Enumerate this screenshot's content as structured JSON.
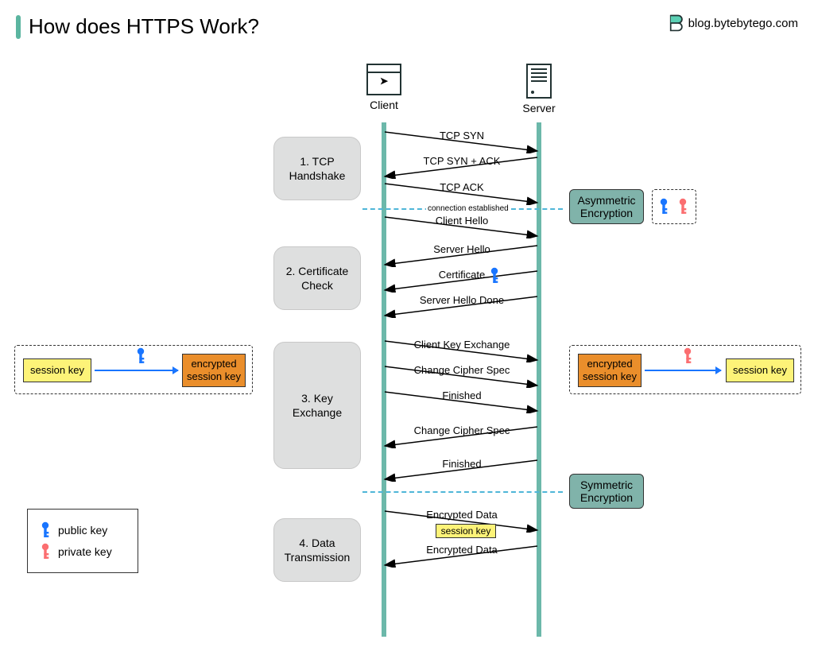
{
  "title": "How does HTTPS Work?",
  "brand": "blog.bytebytego.com",
  "actors": {
    "client": "Client",
    "server": "Server"
  },
  "phases": {
    "p1": "1. TCP Handshake",
    "p2": "2. Certificate Check",
    "p3": "3. Key Exchange",
    "p4": "4. Data Transmission"
  },
  "messages": {
    "m1": "TCP SYN",
    "m2": "TCP SYN + ACK",
    "m3": "TCP ACK",
    "divider1": "connection established",
    "m4": "Client Hello",
    "m5": "Server Hello",
    "m6": "Certificate",
    "m7": "Server Hello Done",
    "m8": "Client Key Exchange",
    "m9": "Change Cipher Spec",
    "m10": "Finished",
    "m11": "Change Cipher Spec",
    "m12": "Finished",
    "m13": "Encrypted  Data",
    "m14": "Encrypted Data",
    "session_key_inline": "session key"
  },
  "encryption": {
    "asym": "Asymmetric Encryption",
    "sym": "Symmetric Encryption"
  },
  "keys": {
    "session": "session key",
    "enc_session": "encrypted session key"
  },
  "legend": {
    "public": "public key",
    "private": "private key"
  },
  "colors": {
    "accent": "#5bb5a0",
    "blue_key": "#1975ff",
    "red_key": "#fb6e70",
    "phase_bg": "#dedfdf",
    "enc_bg": "#80b3aa",
    "yellow": "#fdf378",
    "orange": "#ea8e2b"
  }
}
